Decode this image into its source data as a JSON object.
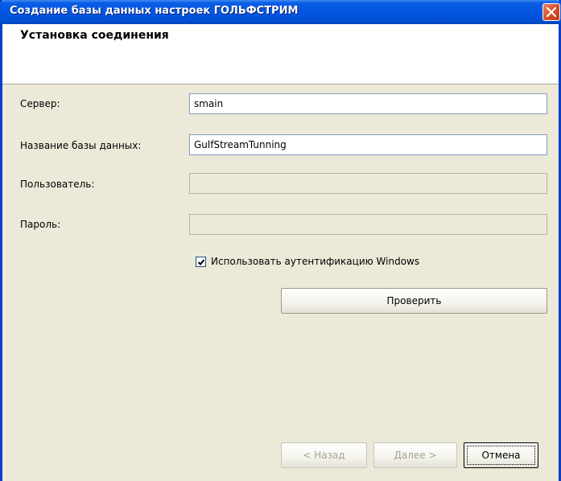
{
  "window": {
    "title": "Создание базы данных настроек ГОЛЬФСТРИМ",
    "close_icon": "close-icon",
    "accent_color": "#0a5ee5"
  },
  "header": {
    "title": "Установка соединения"
  },
  "form": {
    "server": {
      "label": "Сервер:",
      "value": "smain"
    },
    "database": {
      "label": "Название базы данных:",
      "value": "GulfStreamTunning"
    },
    "user": {
      "label": "Пользователь:",
      "value": "",
      "disabled": true
    },
    "password": {
      "label": "Пароль:",
      "value": "",
      "disabled": true
    },
    "windows_auth": {
      "label": "Использовать аутентификацию Windows",
      "checked": true
    },
    "check_button": "Проверить"
  },
  "footer": {
    "back_button": "< Назад",
    "next_button": "Далее >",
    "cancel_button": "Отмена"
  }
}
